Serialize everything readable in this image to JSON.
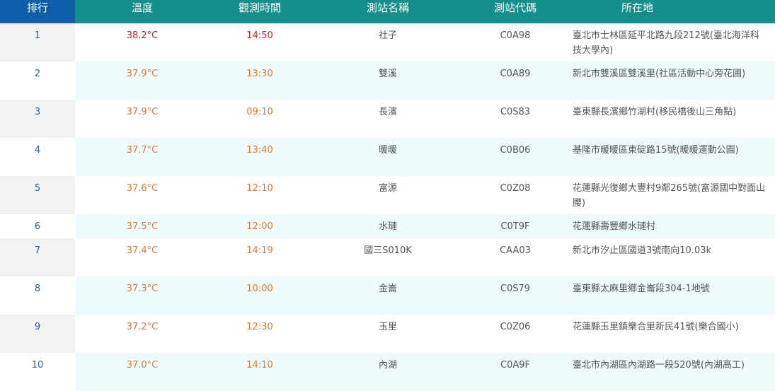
{
  "header": {
    "rank": "排行",
    "temperature": "溫度",
    "obs_time": "觀測時間",
    "station_name": "測站名稱",
    "station_code": "測站代碼",
    "location": "所在地"
  },
  "colors": {
    "header_rank_bg": "#0d5ea8",
    "header_bg": "#148f8c",
    "top_value": "#c8242a",
    "value": "#e07a2e",
    "rank_text": "#2c5c9a",
    "row_alt_bg": "#eefafc"
  },
  "rows": [
    {
      "rank": "1",
      "temp": "38.2°C",
      "time": "14:50",
      "name": "社子",
      "code": "C0A98",
      "location": "臺北市士林區延平北路九段212號(臺北海洋科技大學內)"
    },
    {
      "rank": "2",
      "temp": "37.9°C",
      "time": "13:30",
      "name": "雙溪",
      "code": "C0A89",
      "location": "新北市雙溪區雙溪里(社區活動中心旁花圃)"
    },
    {
      "rank": "3",
      "temp": "37.9°C",
      "time": "09:10",
      "name": "長濱",
      "code": "C0S83",
      "location": "臺東縣長濱鄉竹湖村(移民橋後山三角點)"
    },
    {
      "rank": "4",
      "temp": "37.7°C",
      "time": "13:40",
      "name": "暖暖",
      "code": "C0B06",
      "location": "基隆市暖暖區東碇路15號(暖暖運動公園)"
    },
    {
      "rank": "5",
      "temp": "37.6°C",
      "time": "12:10",
      "name": "富源",
      "code": "C0Z08",
      "location": "花蓮縣光復鄉大豐村9鄰265號(富源國中對面山腰)"
    },
    {
      "rank": "6",
      "temp": "37.5°C",
      "time": "12:00",
      "name": "水璉",
      "code": "C0T9F",
      "location": "花蓮縣壽豐鄉水璉村"
    },
    {
      "rank": "7",
      "temp": "37.4°C",
      "time": "14:19",
      "name": "國三S010K",
      "code": "CAA03",
      "location": "新北市汐止區國道3號南向10.03k"
    },
    {
      "rank": "8",
      "temp": "37.3°C",
      "time": "10:00",
      "name": "金崙",
      "code": "C0S79",
      "location": "臺東縣太麻里鄉金崙段304-1地號"
    },
    {
      "rank": "9",
      "temp": "37.2°C",
      "time": "12:30",
      "name": "玉里",
      "code": "C0Z06",
      "location": "花蓮縣玉里鎮樂合里新民41號(樂合國小)"
    },
    {
      "rank": "10",
      "temp": "37.0°C",
      "time": "14:10",
      "name": "內湖",
      "code": "C0A9F",
      "location": "臺北市內湖區內湖路一段520號(內湖高工)"
    }
  ]
}
